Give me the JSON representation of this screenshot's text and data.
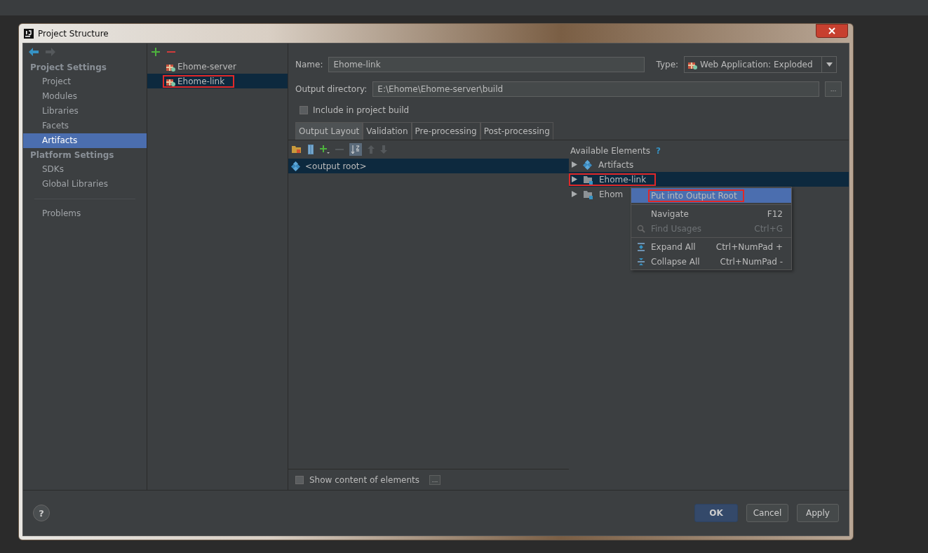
{
  "window": {
    "title": "Project Structure"
  },
  "sidebar": {
    "sections": [
      {
        "heading": "Project Settings",
        "items": [
          {
            "label": "Project",
            "selected": false
          },
          {
            "label": "Modules",
            "selected": false
          },
          {
            "label": "Libraries",
            "selected": false
          },
          {
            "label": "Facets",
            "selected": false
          },
          {
            "label": "Artifacts",
            "selected": true
          }
        ]
      },
      {
        "heading": "Platform Settings",
        "items": [
          {
            "label": "SDKs",
            "selected": false
          },
          {
            "label": "Global Libraries",
            "selected": false
          }
        ]
      }
    ],
    "footer_items": [
      {
        "label": "Problems",
        "selected": false
      }
    ]
  },
  "artifacts": {
    "items": [
      {
        "name": "Ehome-server",
        "selected": false,
        "highlighted": false
      },
      {
        "name": "Ehome-link",
        "selected": true,
        "highlighted": true
      }
    ]
  },
  "form": {
    "name_label": "Name:",
    "name_value": "Ehome-link",
    "type_label": "Type:",
    "type_value": "Web Application: Exploded",
    "output_label": "Output directory:",
    "output_value": "E:\\Ehome\\Ehome-server\\build",
    "browse_button": "...",
    "include_checkbox": {
      "label": "Include in project build",
      "checked": false
    }
  },
  "tabs": [
    {
      "label": "Output Layout",
      "selected": true
    },
    {
      "label": "Validation",
      "selected": false
    },
    {
      "label": "Pre-processing",
      "selected": false
    },
    {
      "label": "Post-processing",
      "selected": false
    }
  ],
  "layout_tree": [
    {
      "label": "<output root>",
      "selected": true
    }
  ],
  "available": {
    "heading": "Available Elements",
    "help": "?",
    "items": [
      {
        "label": "Artifacts",
        "kind": "artifacts",
        "selected": false,
        "highlighted": false
      },
      {
        "label": "Ehome-link",
        "kind": "module",
        "selected": true,
        "highlighted": true
      },
      {
        "label": "Ehom",
        "kind": "module",
        "selected": false,
        "highlighted": false
      }
    ]
  },
  "context_menu": {
    "items": [
      {
        "label": "Put into Output Root",
        "kind": "plain",
        "selected": true,
        "highlighted": true,
        "disabled": false,
        "separator_before": false
      },
      {
        "label": "Navigate",
        "shortcut": "F12",
        "kind": "plain",
        "selected": false,
        "highlighted": false,
        "disabled": false,
        "separator_before": true
      },
      {
        "label": "Find Usages",
        "shortcut": "Ctrl+G",
        "kind": "search",
        "selected": false,
        "highlighted": false,
        "disabled": true,
        "separator_before": false
      },
      {
        "label": "Expand All",
        "shortcut": "Ctrl+NumPad +",
        "kind": "expand",
        "selected": false,
        "highlighted": false,
        "disabled": false,
        "separator_before": true
      },
      {
        "label": "Collapse All",
        "shortcut": "Ctrl+NumPad -",
        "kind": "collapse",
        "selected": false,
        "highlighted": false,
        "disabled": false,
        "separator_before": false
      }
    ]
  },
  "show_content": {
    "label": "Show content of elements",
    "checked": false
  },
  "more_button": "...",
  "help_button": "?",
  "buttons": [
    {
      "label": "OK",
      "default": true
    },
    {
      "label": "Cancel",
      "default": false
    },
    {
      "label": "Apply",
      "default": false
    }
  ]
}
